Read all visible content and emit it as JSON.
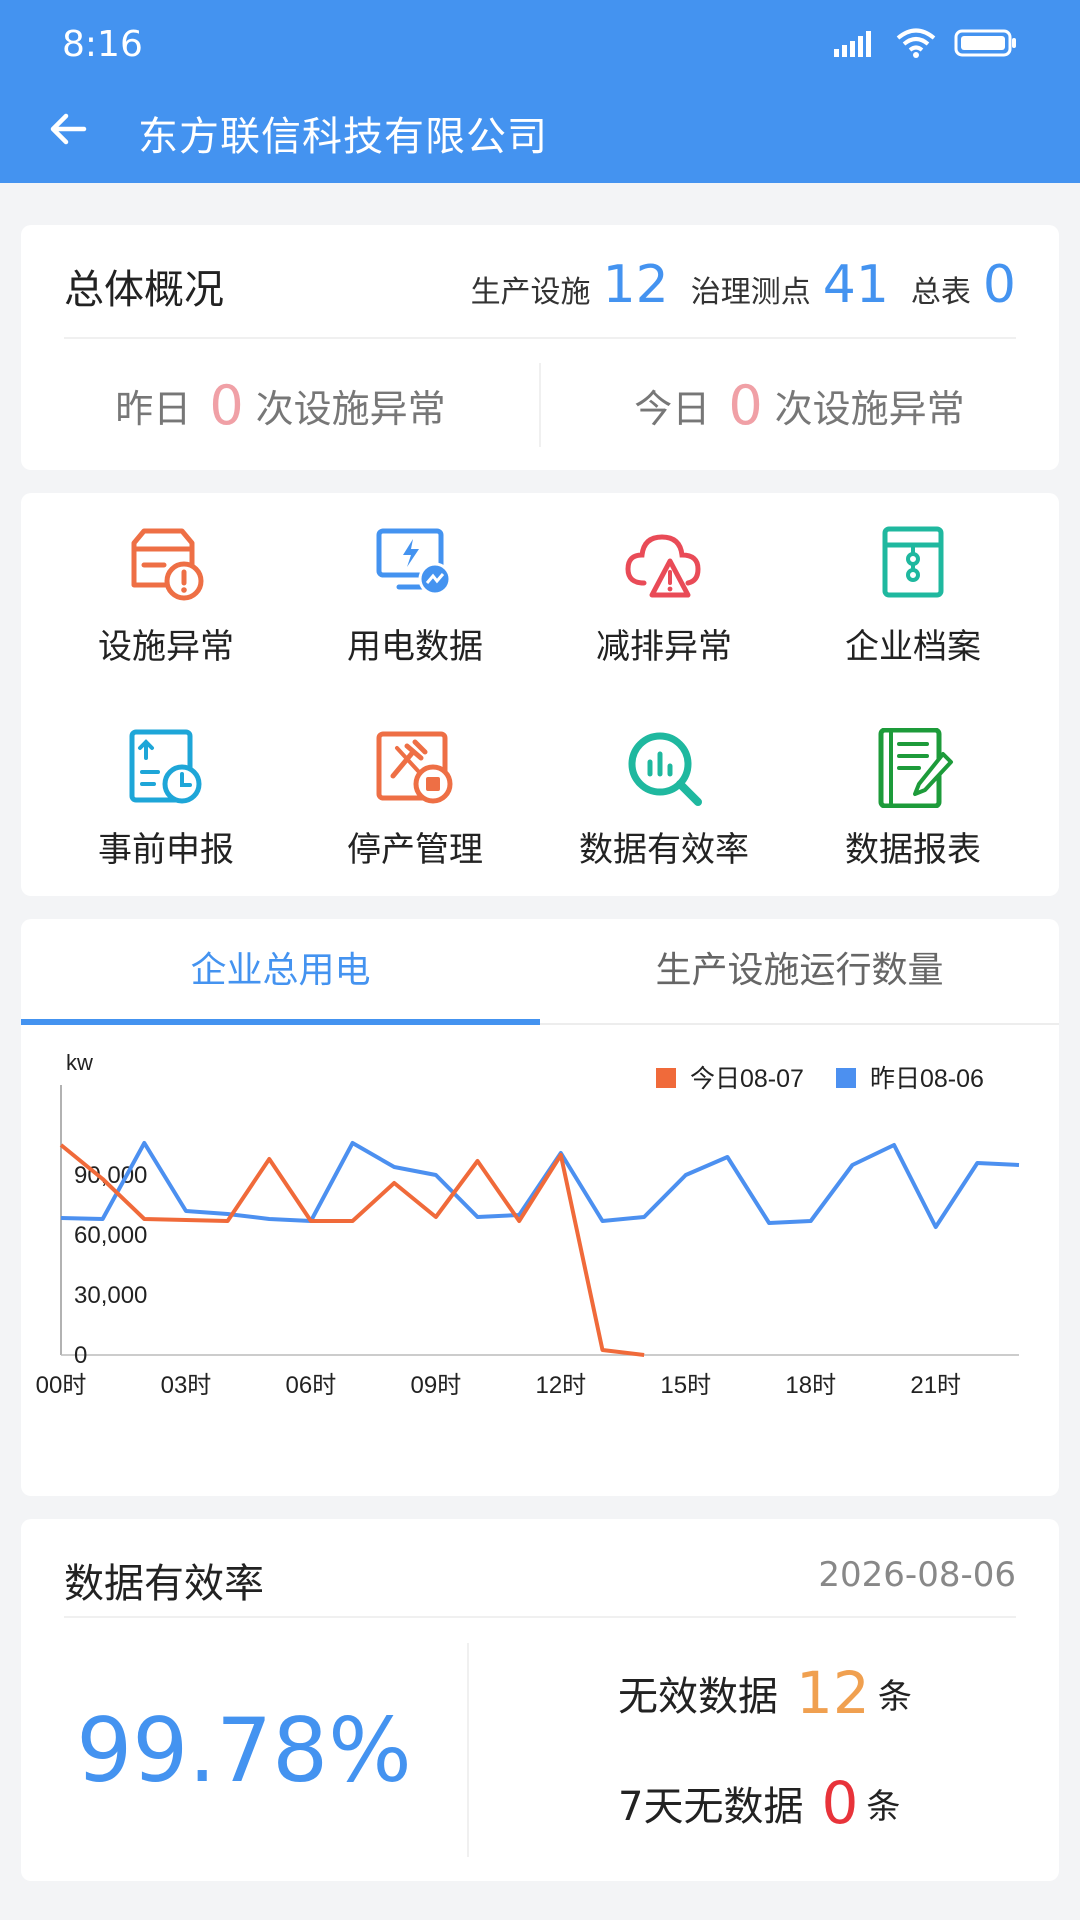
{
  "status_bar": {
    "time": "8:16"
  },
  "app_bar": {
    "title": "东方联信科技有限公司"
  },
  "overview": {
    "title": "总体概况",
    "stats": [
      {
        "label": "生产设施",
        "value": "12"
      },
      {
        "label": "治理测点",
        "value": "41"
      },
      {
        "label": "总表",
        "value": "0"
      }
    ],
    "yesterday": {
      "label": "昨日",
      "count": "0",
      "suffix": "次设施异常"
    },
    "today": {
      "label": "今日",
      "count": "0",
      "suffix": "次设施异常"
    }
  },
  "grid": [
    {
      "label": "设施异常",
      "icon": "facility-alert-icon",
      "color": "#ee6f45"
    },
    {
      "label": "用电数据",
      "icon": "power-monitor-icon",
      "color": "#4493f0"
    },
    {
      "label": "减排异常",
      "icon": "cloud-warning-icon",
      "color": "#e94b57"
    },
    {
      "label": "企业档案",
      "icon": "archive-folder-icon",
      "color": "#1fb89f"
    },
    {
      "label": "事前申报",
      "icon": "report-clock-icon",
      "color": "#1ea6d8"
    },
    {
      "label": "停产管理",
      "icon": "tools-stop-icon",
      "color": "#ee6f45"
    },
    {
      "label": "数据有效率",
      "icon": "chart-search-icon",
      "color": "#1fb89f"
    },
    {
      "label": "数据报表",
      "icon": "notebook-pen-icon",
      "color": "#1d9b3a"
    }
  ],
  "tabs": [
    {
      "label": "企业总用电",
      "active": true
    },
    {
      "label": "生产设施运行数量",
      "active": false
    }
  ],
  "chart_data": {
    "type": "line",
    "ylabel": "kw",
    "ylim": [
      0,
      120000
    ],
    "yticks": [
      "0",
      "30,000",
      "60,000",
      "90,000"
    ],
    "ytick_values": [
      0,
      30000,
      60000,
      90000
    ],
    "x": [
      0,
      1,
      2,
      3,
      4,
      5,
      6,
      7,
      8,
      9,
      10,
      11,
      12,
      13,
      14,
      15,
      16,
      17,
      18,
      19,
      20,
      21,
      22,
      23
    ],
    "xticks": [
      "00时",
      "03时",
      "06时",
      "09时",
      "12时",
      "15时",
      "18时",
      "21时"
    ],
    "xtick_positions": [
      0,
      3,
      6,
      9,
      12,
      15,
      18,
      21
    ],
    "legend_position": "top-right",
    "series": [
      {
        "name": "今日08-07",
        "color": "#f06a3a",
        "values": [
          105000,
          88000,
          68000,
          67500,
          67000,
          98000,
          67000,
          67000,
          86000,
          69000,
          97000,
          67000,
          100000,
          2500,
          0
        ]
      },
      {
        "name": "昨日08-06",
        "color": "#4c90f0",
        "values": [
          68500,
          68000,
          106000,
          72000,
          70500,
          68000,
          67000,
          106000,
          94000,
          90000,
          69000,
          70000,
          101000,
          67000,
          69000,
          90000,
          99000,
          66000,
          67000,
          95000,
          105000,
          64000,
          96000,
          95000
        ]
      }
    ]
  },
  "efficiency": {
    "title": "数据有效率",
    "date": "2026-08-06",
    "percentage": "99.78%",
    "invalid": {
      "label": "无效数据",
      "count": "12",
      "unit": "条"
    },
    "no_data": {
      "label": "7天无数据",
      "count": "0",
      "unit": "条"
    }
  }
}
